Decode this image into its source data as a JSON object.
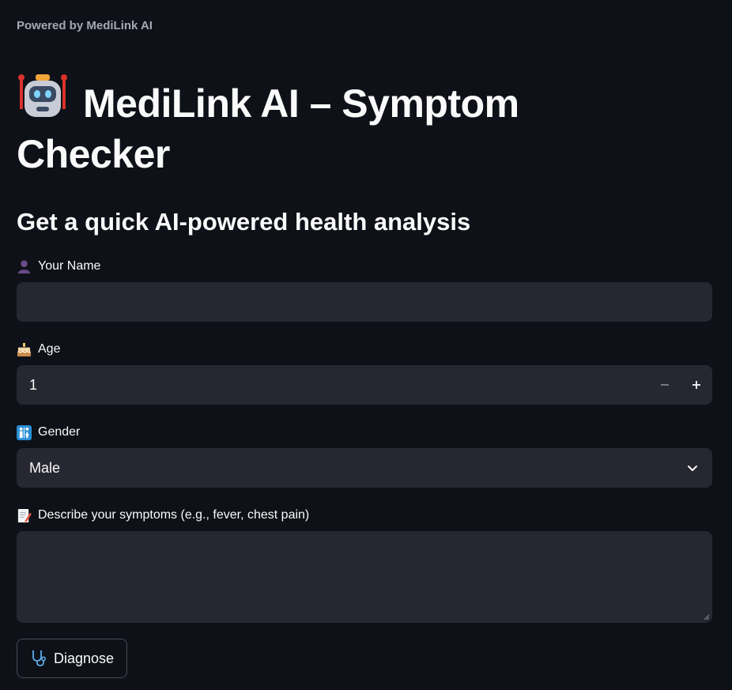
{
  "app": {
    "powered_by": "Powered by MediLink AI",
    "title": "MediLink AI – Symptom Checker",
    "subtitle": "Get a quick AI-powered health analysis"
  },
  "form": {
    "name": {
      "icon": "person-silhouette-icon",
      "label": "Your Name",
      "value": "",
      "placeholder": ""
    },
    "age": {
      "icon": "birthday-cake-icon",
      "label": "Age",
      "value": "1",
      "decrement": "−",
      "increment": "+"
    },
    "gender": {
      "icon": "restroom-icon",
      "label": "Gender",
      "selected": "Male"
    },
    "symptoms": {
      "icon": "memo-icon",
      "label": "Describe your symptoms (e.g., fever, chest pain)",
      "value": "",
      "placeholder": ""
    },
    "submit": {
      "icon": "stethoscope-icon",
      "label": "Diagnose"
    }
  },
  "colors": {
    "background": "#0e1117",
    "field_background": "#262730",
    "text": "#fafafa",
    "muted_text": "#a3a8b4",
    "button_border": "#4a4c57"
  }
}
